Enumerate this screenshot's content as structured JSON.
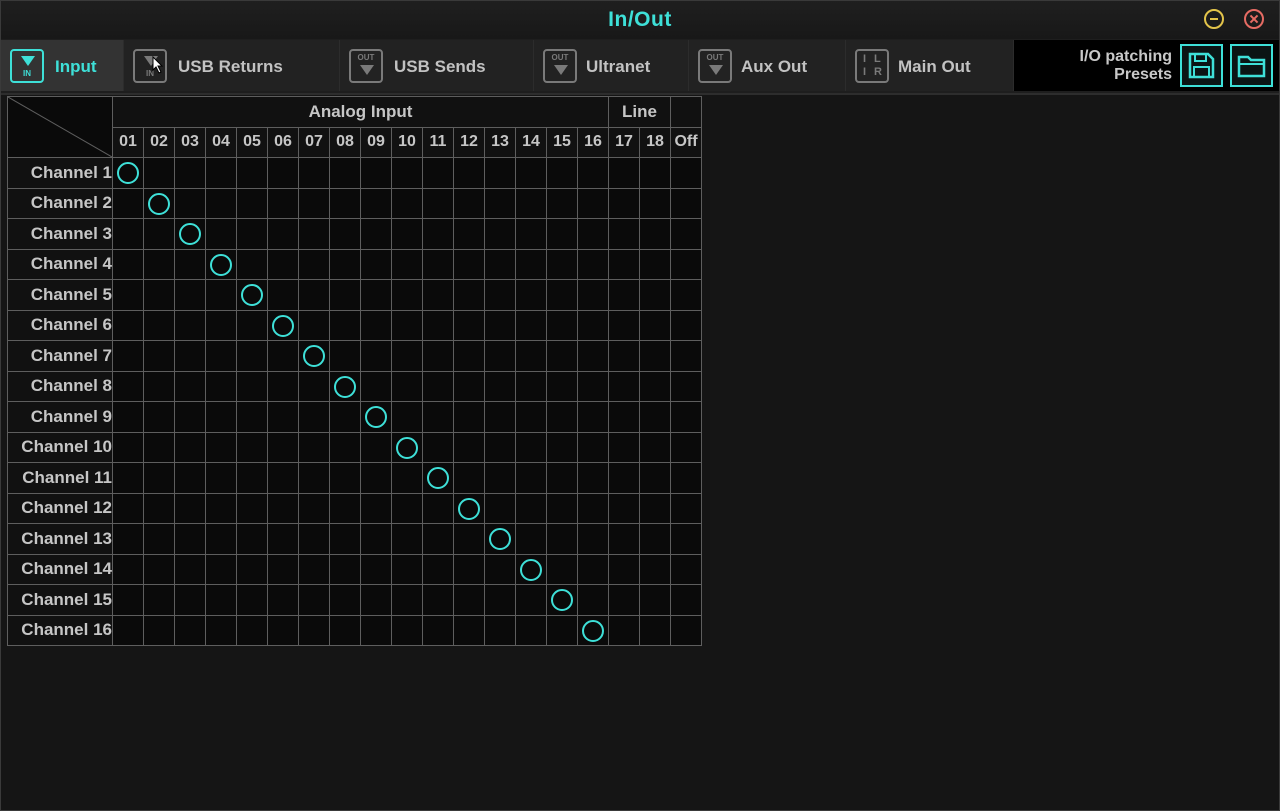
{
  "window": {
    "title": "In/Out"
  },
  "tabs": [
    {
      "label": "Input",
      "icon": "input-icon",
      "icon_text": "IN",
      "active": true
    },
    {
      "label": "USB Returns",
      "icon": "usb-returns-icon",
      "icon_text": "IN",
      "active": false
    },
    {
      "label": "USB Sends",
      "icon": "usb-sends-icon",
      "icon_text": "OUT",
      "active": false
    },
    {
      "label": "Ultranet",
      "icon": "ultranet-icon",
      "icon_text": "OUT",
      "active": false
    },
    {
      "label": "Aux Out",
      "icon": "aux-out-icon",
      "icon_text": "OUT",
      "active": false
    },
    {
      "label": "Main Out",
      "icon": "main-out-icon",
      "icon_text": "L R",
      "active": false
    }
  ],
  "presets": {
    "label_line1": "I/O patching",
    "label_line2": "Presets",
    "save_icon": "save-icon",
    "open_icon": "folder-icon"
  },
  "matrix": {
    "groups": [
      {
        "label": "Analog Input",
        "span": 16
      },
      {
        "label": "Line",
        "span": 2
      },
      {
        "label": "",
        "span": 1
      }
    ],
    "columns": [
      "01",
      "02",
      "03",
      "04",
      "05",
      "06",
      "07",
      "08",
      "09",
      "10",
      "11",
      "12",
      "13",
      "14",
      "15",
      "16",
      "17",
      "18",
      "Off"
    ],
    "rows": [
      {
        "label": "Channel 1",
        "selected": 0
      },
      {
        "label": "Channel 2",
        "selected": 1
      },
      {
        "label": "Channel 3",
        "selected": 2
      },
      {
        "label": "Channel 4",
        "selected": 3
      },
      {
        "label": "Channel 5",
        "selected": 4
      },
      {
        "label": "Channel 6",
        "selected": 5
      },
      {
        "label": "Channel 7",
        "selected": 6
      },
      {
        "label": "Channel 8",
        "selected": 7
      },
      {
        "label": "Channel 9",
        "selected": 8
      },
      {
        "label": "Channel 10",
        "selected": 9
      },
      {
        "label": "Channel 11",
        "selected": 10
      },
      {
        "label": "Channel 12",
        "selected": 11
      },
      {
        "label": "Channel 13",
        "selected": 12
      },
      {
        "label": "Channel 14",
        "selected": 13
      },
      {
        "label": "Channel 15",
        "selected": 14
      },
      {
        "label": "Channel 16",
        "selected": 15
      }
    ]
  },
  "colors": {
    "accent": "#3ee0d8",
    "minimize": "#e3c44a",
    "close": "#e56b63",
    "grid": "#5e5e5e"
  }
}
